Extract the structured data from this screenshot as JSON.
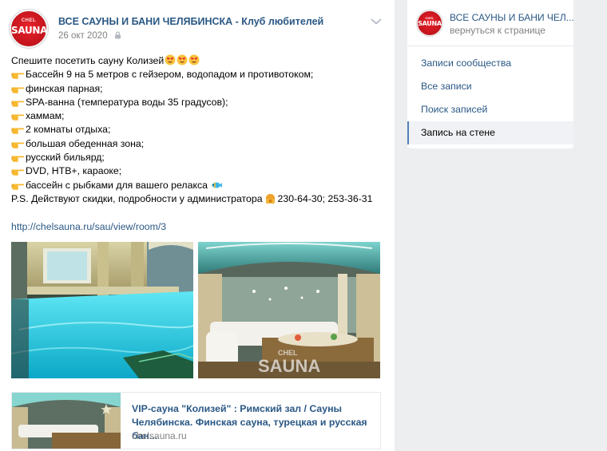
{
  "post": {
    "group_name": "ВСЕ САУНЫ И БАНИ ЧЕЛЯБИНСКА - Клуб любителей",
    "date": "26 окт 2020",
    "avatar_logo": "CHEL SAUNA",
    "lines": [
      {
        "text": "Спешите посетить сауну Колизей",
        "emoji": "heart-eyes"
      },
      {
        "text": "Бассейн 9 на 5 метров с гейзером, водопадом и противотоком;",
        "emoji": "pointing-hand"
      },
      {
        "text": "финская парная;",
        "emoji": "pointing-hand"
      },
      {
        "text": "SPA-ванна (температура воды 35 градусов);",
        "emoji": "pointing-hand"
      },
      {
        "text": "хаммам;",
        "emoji": "pointing-hand"
      },
      {
        "text": "2 комнаты отдыха;",
        "emoji": "pointing-hand"
      },
      {
        "text": "большая обеденная зона;",
        "emoji": "pointing-hand"
      },
      {
        "text": "русский бильярд;",
        "emoji": "pointing-hand"
      },
      {
        "text": "DVD, НТВ+, караоке;",
        "emoji": "pointing-hand"
      },
      {
        "text": "бассейн с рыбками для вашего релакса",
        "emoji": "fish"
      },
      {
        "text_before": "P.S. Действуют скидки, подробности у администратора",
        "text_after": "230-64-30; 253-36-31",
        "emoji": "telephone"
      }
    ],
    "link_url": "http://chelsauna.ru/sau/view/room/3",
    "photo_watermark": "CHEL SAUNA",
    "link_card": {
      "title": "VIP-сауна \"Колизей\" : Римский зал / Сауны Челябинска. Финская сауна, турецкая и русская бан...",
      "domain": "chelsauna.ru"
    }
  },
  "sidebar": {
    "group_name": "ВСЕ САУНЫ И БАНИ ЧЕЛ...",
    "back_label": "вернуться к странице",
    "menu": [
      {
        "label": "Записи сообщества",
        "active": false
      },
      {
        "label": "Все записи",
        "active": false
      },
      {
        "label": "Поиск записей",
        "active": false
      },
      {
        "label": "Запись на стене",
        "active": true
      }
    ]
  },
  "colors": {
    "link": "#2a5885",
    "muted": "#828282",
    "background": "#edeef0",
    "brand_red": "#d11b22",
    "active_menu_border": "#5181b8"
  }
}
